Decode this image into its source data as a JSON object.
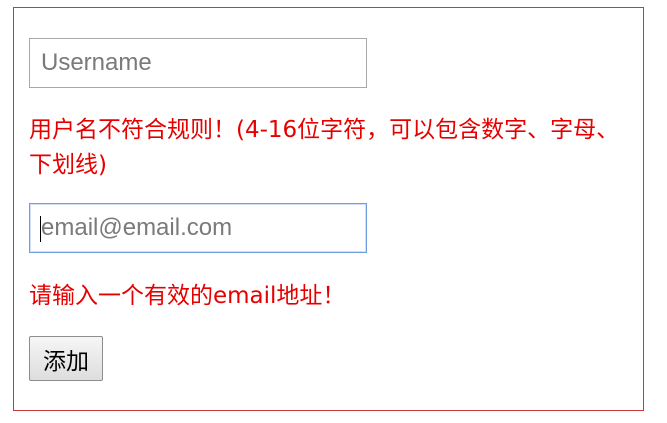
{
  "form": {
    "username_placeholder": "Username",
    "username_error": "用户名不符合规则！(4-16位字符，可以包含数字、字母、下划线)",
    "email_placeholder": "email@email.com",
    "email_error": "请输入一个有效的email地址！",
    "submit_label": "添加"
  },
  "colors": {
    "error_text": "#e60000",
    "frame_border": "#c83a3a",
    "focus_border": "#6f9ee0"
  }
}
